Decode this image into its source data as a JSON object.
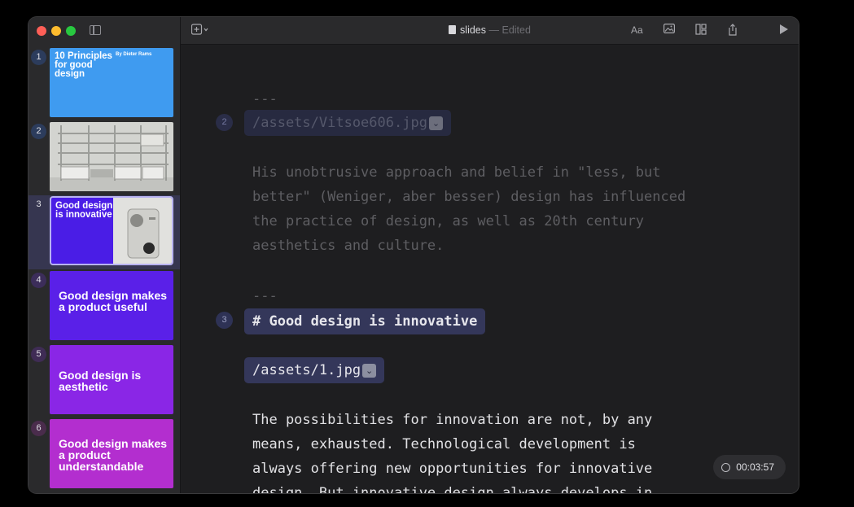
{
  "window": {
    "title": "slides",
    "separator": "—",
    "status": "Edited"
  },
  "toolbar": {
    "add_icon": "plus-square-icon",
    "font_label": "Aa",
    "image_icon": "photo-icon",
    "layout_icon": "layout-icon",
    "share_icon": "share-icon",
    "play_icon": "play-icon"
  },
  "slides": [
    {
      "number": "1",
      "title": "10 Principles for good design",
      "byline": "By Dieter Rams",
      "color": "#3f9bf0"
    },
    {
      "number": "2",
      "color": "#cfd0cc"
    },
    {
      "number": "3",
      "title": "Good design is innovative",
      "color": "#4a1de6"
    },
    {
      "number": "4",
      "title": "Good design makes a product useful",
      "color": "#5a20e8"
    },
    {
      "number": "5",
      "title": "Good design is aesthetic",
      "color": "#8a26e6"
    },
    {
      "number": "6",
      "title": "Good design makes a product understandable",
      "color": "#b32ecf"
    }
  ],
  "editor": {
    "sep1": "---",
    "marker2": "2",
    "image2_path": "/assets/Vitsoe606.jpg",
    "para2": [
      "His unobtrusive approach and belief in \"less, but",
      "better\" (Weniger, aber besser) design has influenced",
      "the practice of design, as well as 20th century",
      "aesthetics and culture."
    ],
    "sep2": "---",
    "marker3": "3",
    "heading3": "# Good design is innovative",
    "image3_path": "/assets/1.jpg",
    "para3": [
      "The possibilities for innovation are not, by any",
      "means, exhausted. Technological development is",
      "always offering new opportunities for innovative",
      "design. But innovative design always develops in"
    ]
  },
  "timer": {
    "value": "00:03:57"
  }
}
